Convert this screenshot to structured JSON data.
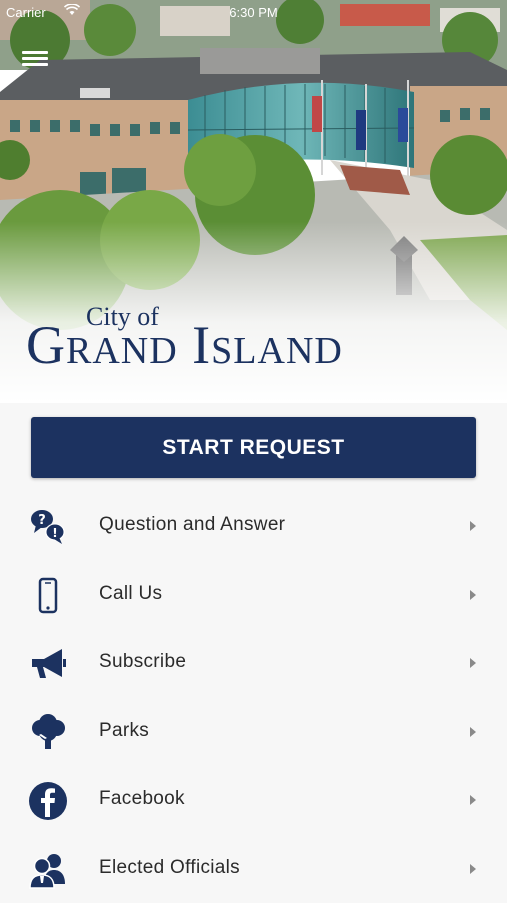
{
  "status_bar": {
    "carrier": "Carrier",
    "time": "6:30 PM"
  },
  "header": {
    "menu_icon": "hamburger-menu-icon"
  },
  "logo": {
    "line1": "City of",
    "line2": "Grand Island"
  },
  "start_request": {
    "label": "START REQUEST"
  },
  "menu_items": [
    {
      "label": "Question and Answer",
      "icon": "question-answer-icon"
    },
    {
      "label": "Call Us",
      "icon": "phone-icon"
    },
    {
      "label": "Subscribe",
      "icon": "megaphone-icon"
    },
    {
      "label": "Parks",
      "icon": "tree-icon"
    },
    {
      "label": "Facebook",
      "icon": "facebook-icon"
    },
    {
      "label": "Elected Officials",
      "icon": "officials-icon"
    }
  ],
  "colors": {
    "brand": "#1c3260",
    "text": "#2b2b2b",
    "background": "#f7f7f7",
    "chevron": "#8a8a8a"
  }
}
